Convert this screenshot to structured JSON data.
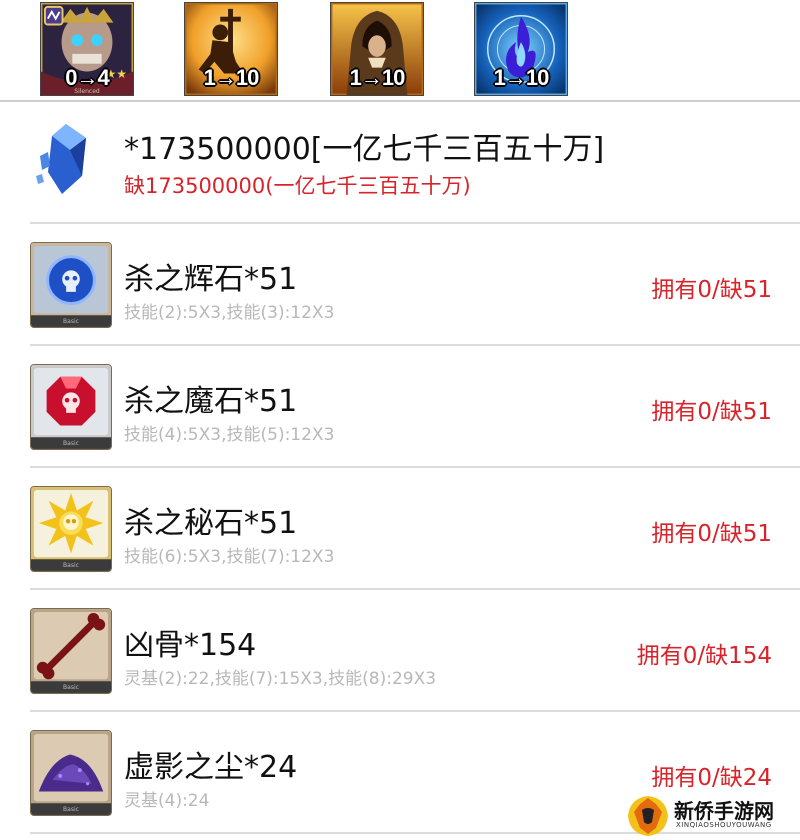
{
  "skills": [
    {
      "id": "skill-1",
      "level_text": "0→4",
      "caption": "Silenced",
      "stars": "★★",
      "icon": "skull-crown-icon",
      "colors": [
        "#2b2340",
        "#8a6f3a"
      ]
    },
    {
      "id": "skill-2",
      "level_text": "1→10",
      "caption": "",
      "stars": "",
      "icon": "kneeling-knight-icon",
      "colors": [
        "#7a3b0c",
        "#f4b23a"
      ]
    },
    {
      "id": "skill-3",
      "level_text": "1→10",
      "caption": "",
      "stars": "",
      "icon": "hooded-figure-icon",
      "colors": [
        "#5b2a08",
        "#f2a536"
      ]
    },
    {
      "id": "skill-4",
      "level_text": "1→10",
      "caption": "",
      "stars": "",
      "icon": "blue-flame-icon",
      "colors": [
        "#062a5a",
        "#2a8fe0"
      ]
    }
  ],
  "qp": {
    "icon": "crystal-icon",
    "amount_text": "*173500000[一亿七千三百五十万]",
    "shortage_text": "缺173500000(一亿七千三百五十万)"
  },
  "materials": [
    {
      "icon": "blue-gem-icon",
      "name": "杀之辉石*51",
      "source": "技能(2):5X3,技能(3):12X3",
      "status": "拥有0/缺51",
      "color": "#2a5fd0",
      "bg": "#b9c6d6"
    },
    {
      "icon": "red-gem-icon",
      "name": "杀之魔石*51",
      "source": "技能(4):5X3,技能(5):12X3",
      "status": "拥有0/缺51",
      "color": "#c8102e",
      "bg": "#d9dde2"
    },
    {
      "icon": "gold-gem-icon",
      "name": "杀之秘石*51",
      "source": "技能(6):5X3,技能(7):12X3",
      "status": "拥有0/缺51",
      "color": "#f3c21a",
      "bg": "#f3efd8"
    },
    {
      "icon": "bone-icon",
      "name": "凶骨*154",
      "source": "灵基(2):22,技能(7):15X3,技能(8):29X3",
      "status": "拥有0/缺154",
      "color": "#7a1414",
      "bg": "#d8c8b4"
    },
    {
      "icon": "dust-pile-icon",
      "name": "虚影之尘*24",
      "source": "灵基(4):24",
      "status": "拥有0/缺24",
      "color": "#4a2a8a",
      "bg": "#d8c8b4"
    }
  ],
  "watermark": {
    "title": "新侨手游网",
    "subtitle": "XINQIAOSHOUYOUWANG"
  },
  "colors": {
    "shortage": "#d8232a",
    "divider": "#dcdcdc",
    "source_text": "#b8b8b8"
  }
}
